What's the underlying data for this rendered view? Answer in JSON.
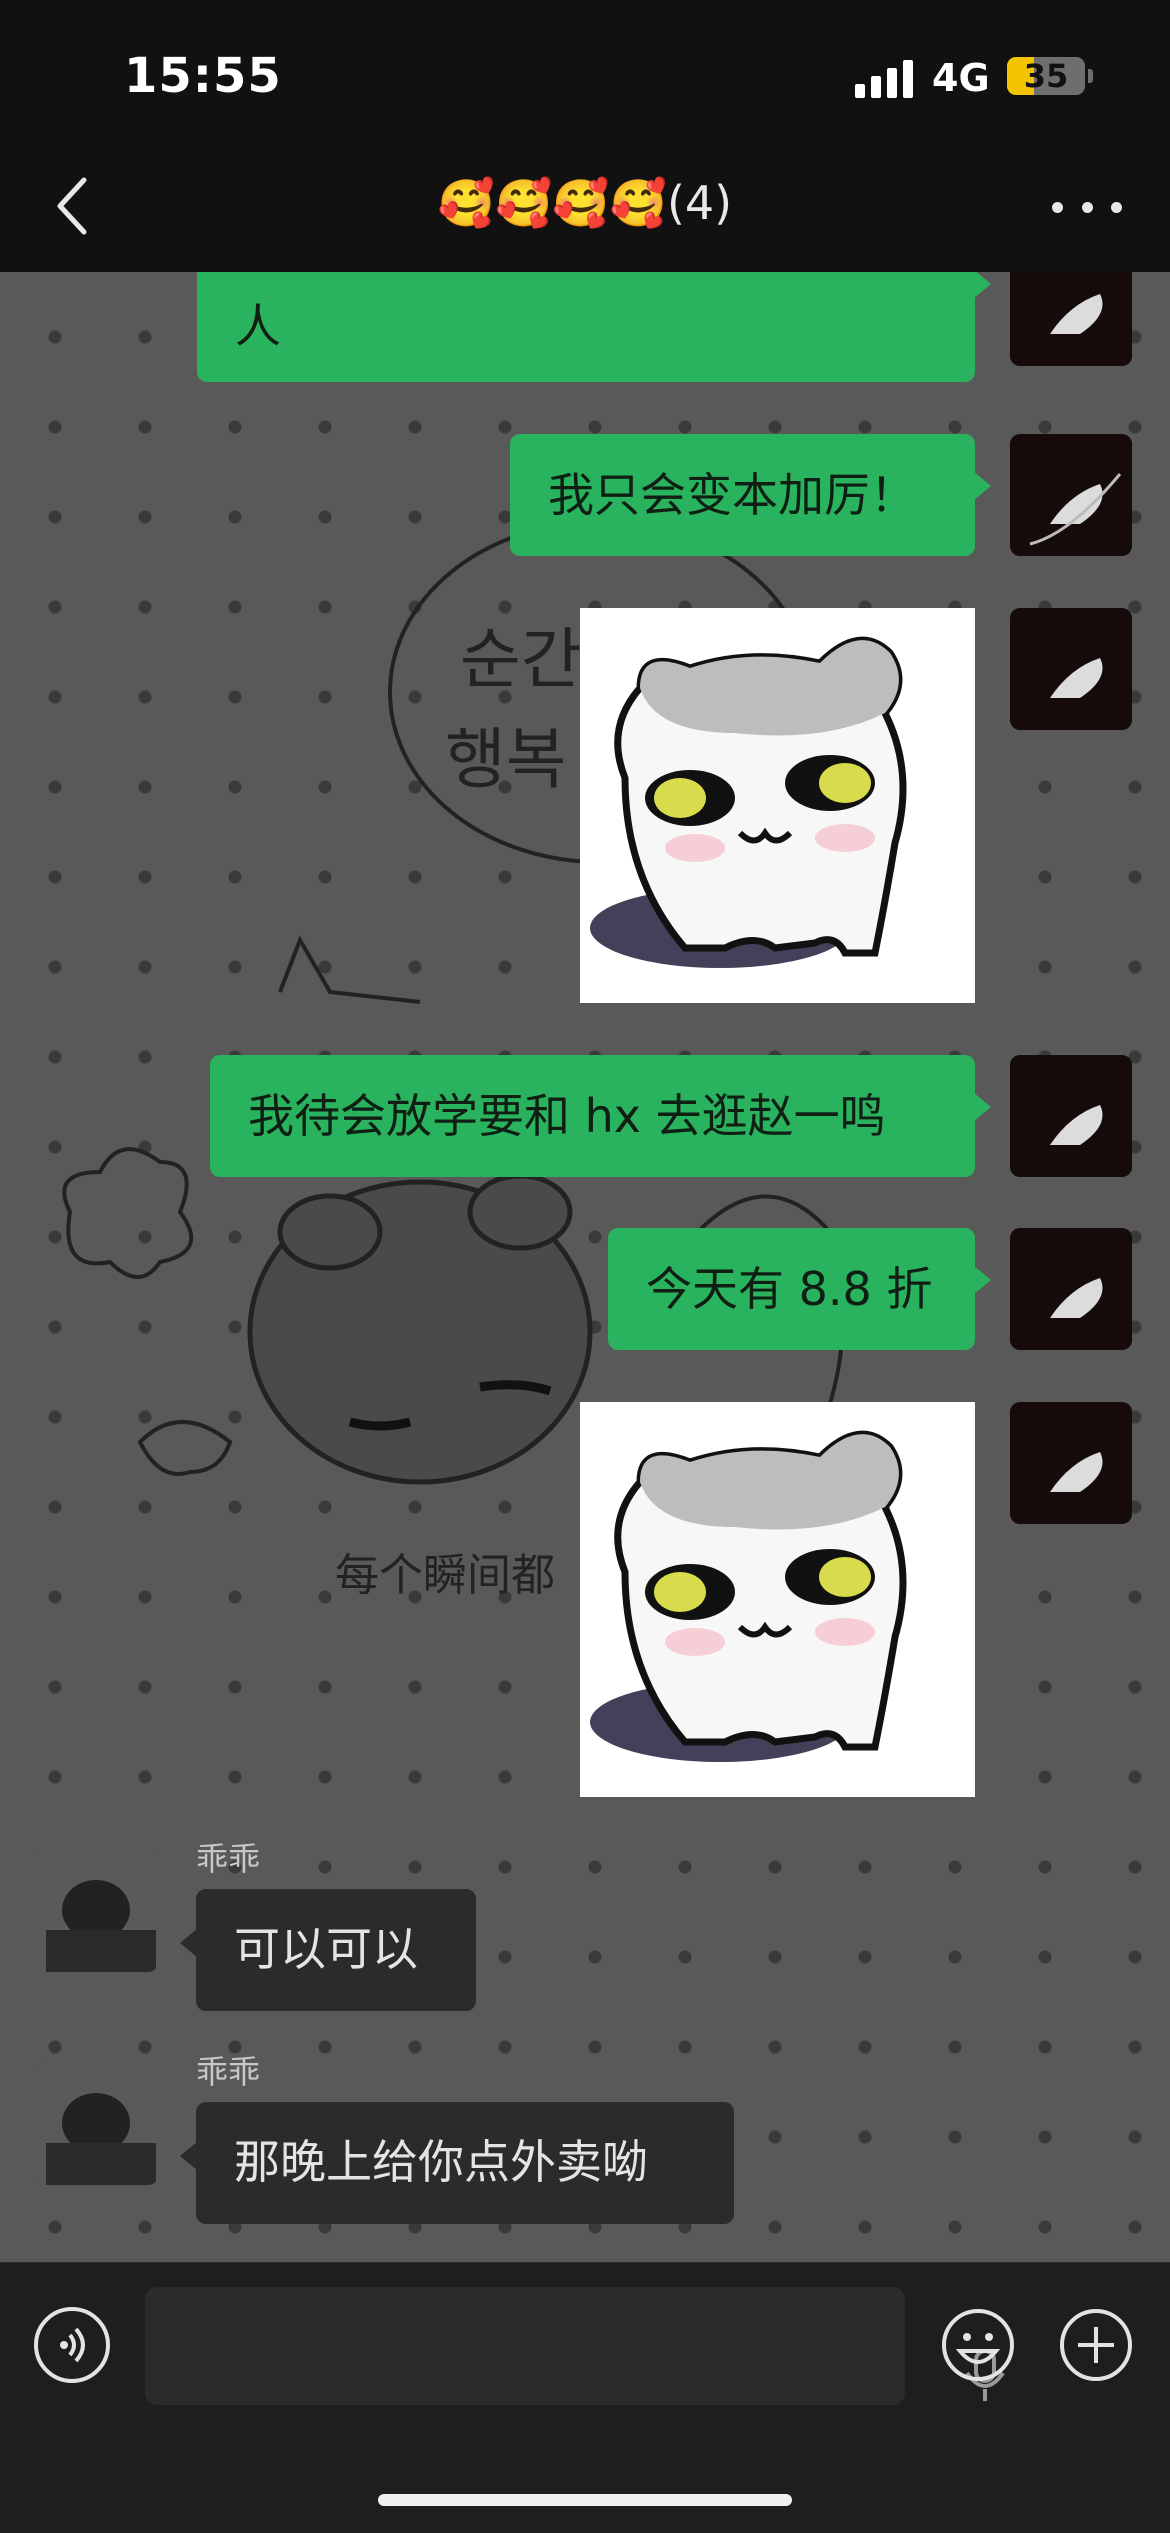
{
  "status_bar": {
    "time": "15:55",
    "network": "4G",
    "battery": "35",
    "battery_level_percent": 35,
    "battery_color": "#f5c400"
  },
  "header": {
    "back_icon": "chevron-left-icon",
    "title": "🥰🥰🥰🥰(4)",
    "more_icon": "ellipsis-icon"
  },
  "messages": [
    {
      "from": "me",
      "type": "text",
      "text": "人"
    },
    {
      "from": "me",
      "type": "text",
      "text": "我只会变本加厉！"
    },
    {
      "from": "me",
      "type": "sticker",
      "sticker": "grumpy-cat-sticker"
    },
    {
      "from": "me",
      "type": "text",
      "text": "我待会放学要和 hx 去逛赵一鸣"
    },
    {
      "from": "me",
      "type": "text",
      "text": "今天有 8.8 折"
    },
    {
      "from": "me",
      "type": "sticker",
      "sticker": "grumpy-cat-sticker"
    },
    {
      "from": "乖乖",
      "type": "text",
      "sender": "乖乖",
      "text": "可以可以"
    },
    {
      "from": "乖乖",
      "type": "text",
      "sender": "乖乖",
      "text": "那晚上给你点外卖呦"
    }
  ],
  "wallpaper_text": {
    "bubble_line1": "순간",
    "bubble_line2": "행복",
    "bottom_caption": "每个瞬间都"
  },
  "input_bar": {
    "voice_icon": "voice-icon",
    "mic_icon": "microphone-icon",
    "emoji_icon": "smiley-icon",
    "plus_icon": "plus-circle-icon"
  },
  "colors": {
    "my_bubble": "#2ab35e",
    "their_bubble": "#2b2b2b",
    "header_bg": "#111111"
  }
}
